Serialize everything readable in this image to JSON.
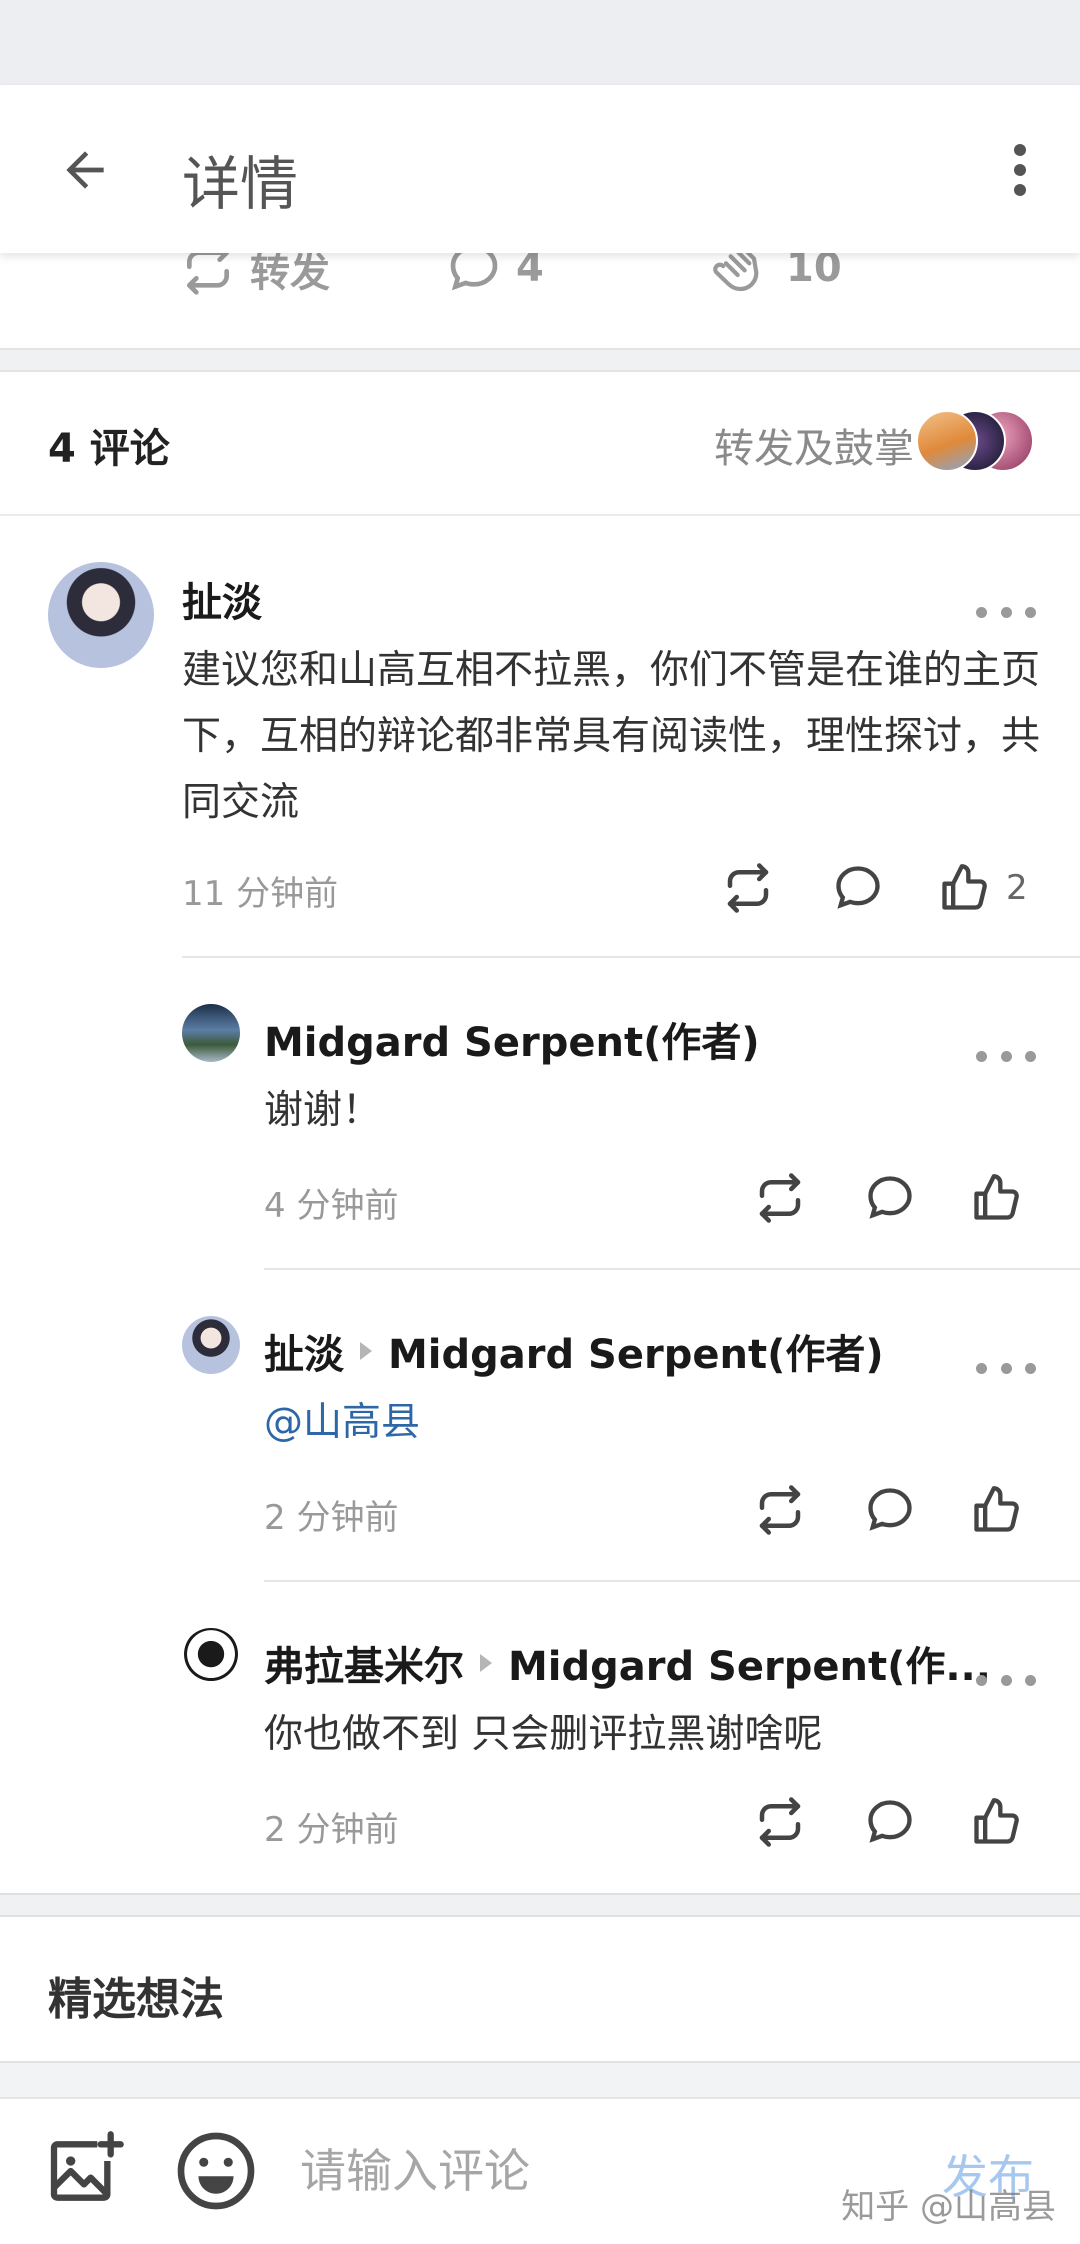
{
  "app_bar": {
    "title": "详情"
  },
  "action_strip": {
    "repost_label": "转发",
    "comment_count": "4",
    "clap_count": "10"
  },
  "comments_header": {
    "count_label": "4 评论",
    "reposts_label": "转发及鼓掌"
  },
  "comments": [
    {
      "author": "扯淡",
      "reply_to": "",
      "body": "建议您和山高互相不拉黑，你们不管是在谁的主页下，互相的辩论都非常具有阅读性，理性探讨，共同交流",
      "time": "11 分钟前",
      "likes": "2"
    },
    {
      "author": "Midgard Serpent(作者)",
      "reply_to": "",
      "body": "谢谢！",
      "time": "4 分钟前",
      "likes": ""
    },
    {
      "author": "扯淡",
      "reply_to": "Midgard Serpent(作者)",
      "body": "@山高县",
      "time": "2 分钟前",
      "likes": ""
    },
    {
      "author": "弗拉基米尔",
      "reply_to": "Midgard Serpent(作...",
      "body": "你也做不到 只会删评拉黑谢啥呢",
      "time": "2 分钟前",
      "likes": ""
    }
  ],
  "featured": {
    "title": "精选想法"
  },
  "input_bar": {
    "placeholder": "请输入评论",
    "send_label": "发布",
    "watermark": "知乎 @山高县"
  },
  "colors": {
    "mention": "#2e67a8",
    "send_disabled": "#a6c8ef",
    "muted": "#999999"
  },
  "icons": [
    "arrow-left-icon",
    "more-vertical-icon",
    "repost-icon",
    "comment-icon",
    "clap-icon",
    "like-icon",
    "image-add-icon",
    "emoji-icon",
    "ellipsis-icon"
  ]
}
